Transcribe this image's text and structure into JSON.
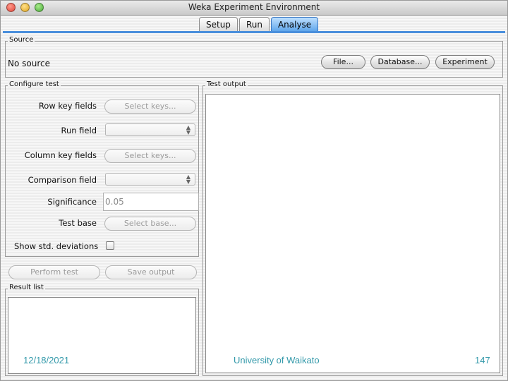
{
  "window": {
    "title": "Weka Experiment Environment"
  },
  "tabs": [
    {
      "label": "Setup"
    },
    {
      "label": "Run"
    },
    {
      "label": "Analyse",
      "active": true
    }
  ],
  "source": {
    "legend": "Source",
    "status": "No source",
    "buttons": {
      "file": "File...",
      "database": "Database...",
      "experiment": "Experiment"
    }
  },
  "configure": {
    "legend": "Configure test",
    "row_key_label": "Row key fields",
    "row_key_button": "Select keys...",
    "run_field_label": "Run field",
    "column_key_label": "Column key fields",
    "column_key_button": "Select keys...",
    "comparison_label": "Comparison field",
    "significance_label": "Significance",
    "significance_value": "0.05",
    "test_base_label": "Test base",
    "test_base_button": "Select base...",
    "show_std_label": "Show std. deviations",
    "show_std_checked": false
  },
  "actions": {
    "perform": "Perform test",
    "save": "Save output"
  },
  "result_list": {
    "legend": "Result list"
  },
  "test_output": {
    "legend": "Test output"
  },
  "footer": {
    "date": "12/18/2021",
    "org": "University of Waikato",
    "page": "147"
  },
  "colors": {
    "accent": "#4a8fdc",
    "footer_text": "#3399aa"
  }
}
